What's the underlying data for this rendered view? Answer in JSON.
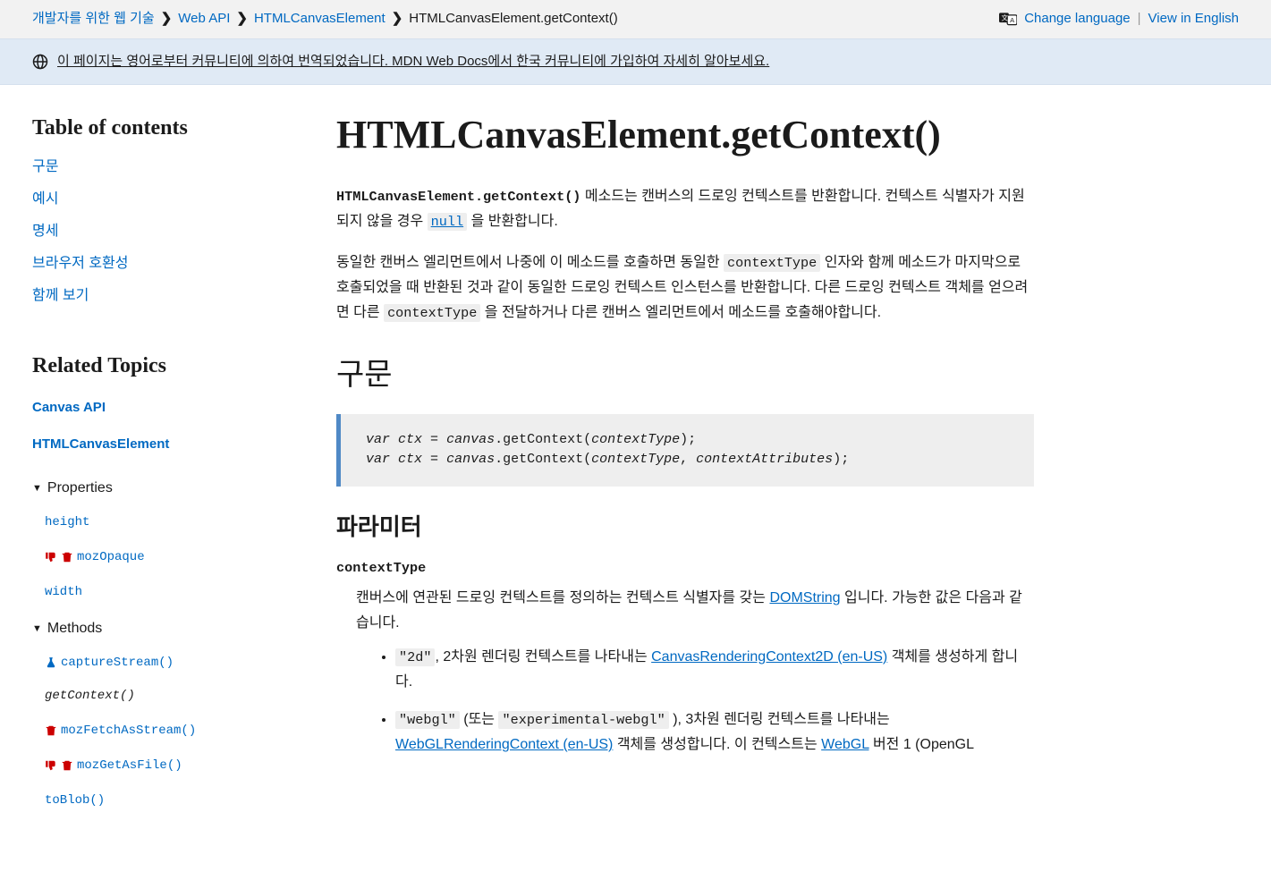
{
  "breadcrumb": {
    "items": [
      {
        "label": "개발자를 위한 웹 기술"
      },
      {
        "label": "Web API"
      },
      {
        "label": "HTMLCanvasElement"
      }
    ],
    "current": "HTMLCanvasElement.getContext()"
  },
  "lang": {
    "change": "Change language",
    "view_en": "View in English"
  },
  "notice": {
    "text": "이 페이지는 영어로부터 커뮤니티에 의하여 번역되었습니다. MDN Web Docs에서 한국 커뮤니티에 가입하여 자세히 알아보세요."
  },
  "toc": {
    "heading": "Table of contents",
    "items": [
      "구문",
      "예시",
      "명세",
      "브라우저 호환성",
      "함께 보기"
    ]
  },
  "related": {
    "heading": "Related Topics",
    "api": "Canvas API",
    "element": "HTMLCanvasElement",
    "properties_label": "Properties",
    "properties": [
      {
        "name": "height",
        "icons": []
      },
      {
        "name": "mozOpaque",
        "icons": [
          "thumb",
          "trash"
        ]
      },
      {
        "name": "width",
        "icons": []
      }
    ],
    "methods_label": "Methods",
    "methods": [
      {
        "name": "captureStream()",
        "icons": [
          "flask"
        ]
      },
      {
        "name": "getContext()",
        "icons": [],
        "current": true
      },
      {
        "name": "mozFetchAsStream()",
        "icons": [
          "trash"
        ]
      },
      {
        "name": "mozGetAsFile()",
        "icons": [
          "thumb",
          "trash"
        ]
      },
      {
        "name": "toBlob()",
        "icons": []
      }
    ]
  },
  "article": {
    "title": "HTMLCanvasElement.getContext()",
    "intro_code": "HTMLCanvasElement.getContext()",
    "intro_1a": " 메소드는 캔버스의 드로잉 컨텍스트를 반환합니다. 컨텍스트 식별자가 지원되지 않을 경우 ",
    "intro_null": "null",
    "intro_1b": " 을 반환합니다.",
    "para2_a": "동일한 캔버스 엘리먼트에서 나중에 이 메소드를 호출하면 동일한 ",
    "para2_code1": "contextType",
    "para2_b": " 인자와 함께 메소드가 마지막으로 호출되었을 때 반환된 것과 같이 동일한 드로잉 컨텍스트 인스턴스를 반환합니다. 다른 드로잉 컨텍스트 객체를 얻으려면 다른 ",
    "para2_code2": "contextType",
    "para2_c": " 을 전달하거나 다른 캔버스 엘리먼트에서 메소드를 호출해야합니다.",
    "syntax_heading": "구문",
    "syntax_code_line1": "var ctx = canvas.getContext(contextType);",
    "syntax_code_line2": "var ctx = canvas.getContext(contextType, contextAttributes);",
    "params_heading": "파라미터",
    "param1_name": "contextType",
    "param1_desc_a": "캔버스에 연관된 드로잉 컨텍스트를 정의하는 컨텍스트 식별자를 갖는 ",
    "param1_desc_link": "DOMString",
    "param1_desc_b": " 입니다. 가능한 값은 다음과 같습니다.",
    "val1_code": "\"2d\"",
    "val1_a": ", 2차원 렌더링 컨텍스트를 나타내는 ",
    "val1_link": "CanvasRenderingContext2D (en-US)",
    "val1_b": " 객체를 생성하게 합니다.",
    "val2_code1": "\"webgl\"",
    "val2_a": " (또는 ",
    "val2_code2": "\"experimental-webgl\"",
    "val2_b": " ), 3차원 렌더링 컨텍스트를 나타내는 ",
    "val2_link1": "WebGLRenderingContext (en-US)",
    "val2_c": " 객체를 생성합니다. 이 컨텍스트는 ",
    "val2_link2": "WebGL",
    "val2_d": " 버전 1 (OpenGL"
  }
}
